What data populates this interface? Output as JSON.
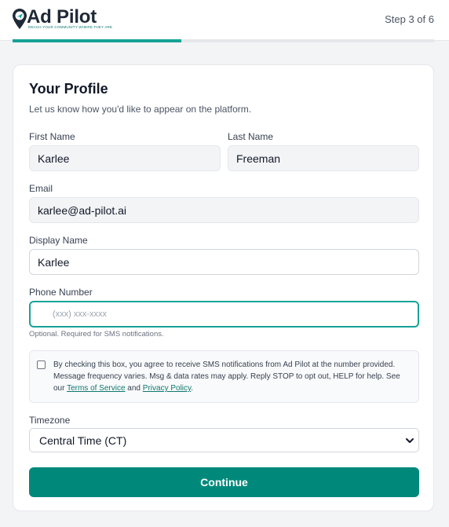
{
  "header": {
    "logo_text": "Ad Pilot",
    "logo_tagline": "REACH YOUR COMMUNITY WHERE THEY ARE",
    "step": "Step 3 of 6",
    "progress": 0.4
  },
  "form": {
    "title": "Your Profile",
    "subtitle": "Let us know how you'd like to appear on the platform.",
    "first_name": {
      "label": "First Name",
      "value": "Karlee"
    },
    "last_name": {
      "label": "Last Name",
      "value": "Freeman"
    },
    "email": {
      "label": "Email",
      "value": "karlee@ad-pilot.ai"
    },
    "display_name": {
      "label": "Display Name",
      "value": "Karlee"
    },
    "phone": {
      "label": "Phone Number",
      "placeholder": "(xxx) xxx-xxxx",
      "hint": "Optional. Required for SMS notifications."
    },
    "consent": {
      "text_before": "By checking this box, you agree to receive SMS notifications from Ad Pilot at the number provided. Message frequency varies. Msg & data rates may apply. Reply STOP to opt out, HELP for help. See our ",
      "terms_link": "Terms of Service",
      "and": " and ",
      "privacy_link": "Privacy Policy",
      "end": ".",
      "checked": false
    },
    "timezone": {
      "label": "Timezone",
      "value": "Central Time (CT)"
    },
    "continue_label": "Continue"
  },
  "colors": {
    "accent": "#14a396",
    "button": "#00897b"
  }
}
